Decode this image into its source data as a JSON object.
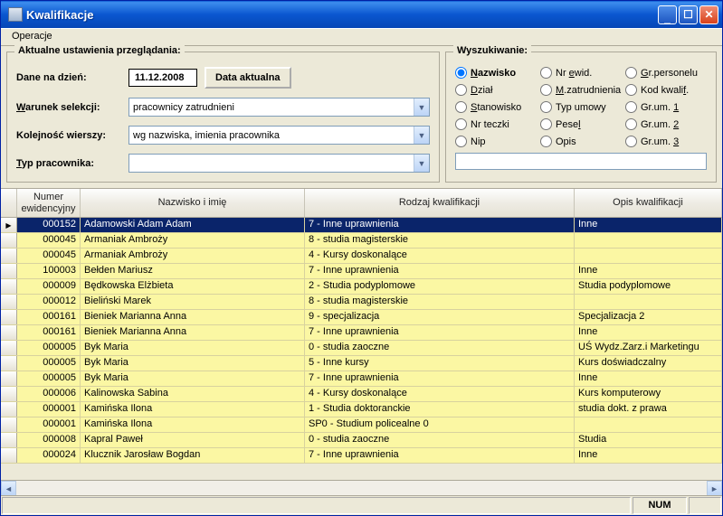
{
  "window": {
    "title": "Kwalifikacje"
  },
  "menu": {
    "operations": "Operacje"
  },
  "settings": {
    "legend": "Aktualne ustawienia przeglądania:",
    "date_label": "Dane na dzień:",
    "date_value": "11.12.2008",
    "date_button": "Data aktualna",
    "selection_label": "Warunek selekcji:",
    "selection_underline": "W",
    "selection_value": "pracownicy zatrudnieni",
    "order_label": "Kolejność wierszy:",
    "order_value": "wg nazwiska, imienia pracownika",
    "type_label": "Typ pracownika:",
    "type_underline": "T",
    "type_value": ""
  },
  "search": {
    "legend": "Wyszukiwanie:",
    "options": [
      {
        "label": "Nazwisko",
        "ul": "N",
        "checked": true
      },
      {
        "label": "Nr ewid.",
        "ul": "e"
      },
      {
        "label": "Gr.personelu",
        "ul": "G"
      },
      {
        "label": "Dział",
        "ul": "D"
      },
      {
        "label": "M.zatrudnienia",
        "ul": "M"
      },
      {
        "label": "Kod kwalif.",
        "ul": "f"
      },
      {
        "label": "Stanowisko",
        "ul": "S"
      },
      {
        "label": "Typ umowy",
        "ul": ""
      },
      {
        "label": "Gr.um. 1",
        "ul": "1"
      },
      {
        "label": "Nr teczki",
        "ul": ""
      },
      {
        "label": "Pesel",
        "ul": "l"
      },
      {
        "label": "Gr.um. 2",
        "ul": "2"
      },
      {
        "label": "Nip",
        "ul": ""
      },
      {
        "label": "Opis",
        "ul": ""
      },
      {
        "label": "Gr.um. 3",
        "ul": "3"
      }
    ],
    "input": ""
  },
  "grid": {
    "headers": {
      "c1": "Numer\newidencyjny",
      "c2": "Nazwisko i imię",
      "c3": "Rodzaj kwalifikacji",
      "c4": "Opis kwalifikacji"
    },
    "rows": [
      {
        "sel": true,
        "num": "000152",
        "name": "Adamowski Adam Adam",
        "kind": "7 - Inne uprawnienia",
        "desc": "Inne"
      },
      {
        "num": "000045",
        "name": "Armaniak Ambroży",
        "kind": "8 - studia magisterskie",
        "desc": ""
      },
      {
        "num": "000045",
        "name": "Armaniak Ambroży",
        "kind": "4 - Kursy doskonalące",
        "desc": ""
      },
      {
        "num": "100003",
        "name": "Bełden Mariusz",
        "kind": "7 - Inne uprawnienia",
        "desc": "Inne"
      },
      {
        "num": "000009",
        "name": "Będkowska Elżbieta",
        "kind": "2 - Studia podyplomowe",
        "desc": "Studia podyplomowe"
      },
      {
        "num": "000012",
        "name": "Bieliński Marek",
        "kind": "8 - studia magisterskie",
        "desc": ""
      },
      {
        "num": "000161",
        "name": "Bieniek Marianna Anna",
        "kind": "9 - specjalizacja",
        "desc": "Specjalizacja 2"
      },
      {
        "num": "000161",
        "name": "Bieniek Marianna Anna",
        "kind": "7 - Inne uprawnienia",
        "desc": "Inne"
      },
      {
        "num": "000005",
        "name": "Byk Maria",
        "kind": "0 - studia zaoczne",
        "desc": "UŚ Wydz.Zarz.i Marketingu"
      },
      {
        "num": "000005",
        "name": "Byk Maria",
        "kind": "5 - Inne kursy",
        "desc": "Kurs doświadczalny"
      },
      {
        "num": "000005",
        "name": "Byk Maria",
        "kind": "7 - Inne uprawnienia",
        "desc": "Inne"
      },
      {
        "num": "000006",
        "name": "Kalinowska Sabina",
        "kind": "4 - Kursy doskonalące",
        "desc": "Kurs komputerowy"
      },
      {
        "num": "000001",
        "name": "Kamińska Ilona",
        "kind": "1 - Studia doktoranckie",
        "desc": "studia dokt. z prawa"
      },
      {
        "num": "000001",
        "name": "Kamińska Ilona",
        "kind": "SP0 - Studium policealne 0",
        "desc": ""
      },
      {
        "num": "000008",
        "name": "Kapral Paweł",
        "kind": "0 - studia zaoczne",
        "desc": "Studia"
      },
      {
        "num": "000024",
        "name": "Klucznik Jarosław Bogdan",
        "kind": "7 - Inne uprawnienia",
        "desc": "Inne"
      }
    ]
  },
  "status": {
    "num": "NUM"
  }
}
